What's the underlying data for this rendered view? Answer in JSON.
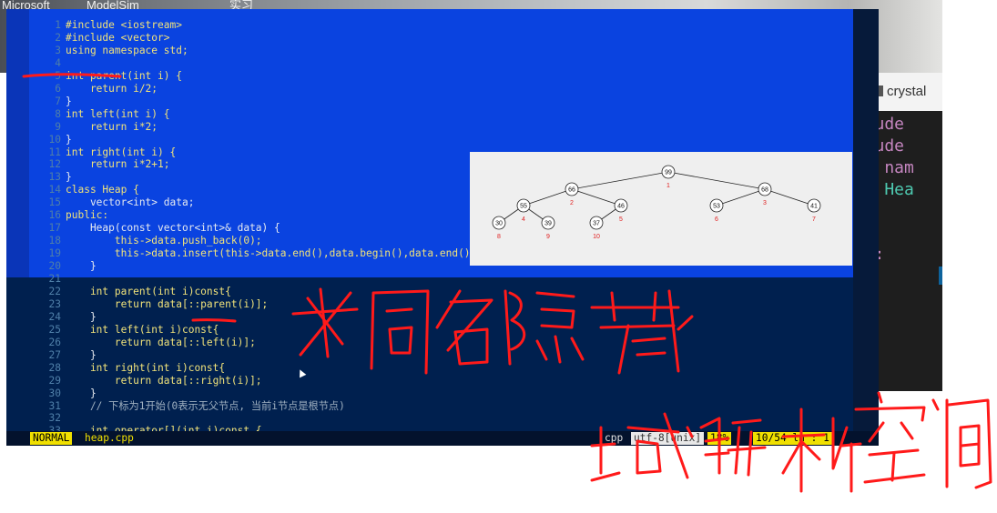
{
  "desktop": {
    "taskbar_items": [
      "Microsoft",
      "ModelSim",
      "实习"
    ]
  },
  "side_window": {
    "tab_label": "crystal",
    "code_fragments": [
      {
        "text": "nclude",
        "color": "#c586c0"
      },
      {
        "text": "nclude",
        "color": "#c586c0"
      },
      {
        "text": "ing nam",
        "color": "#c586c0"
      },
      {
        "text": "ass Hea",
        "color": "#4ec9b0"
      },
      {
        "text": "lic:",
        "color": "#c586c0"
      }
    ]
  },
  "editor": {
    "lines": [
      {
        "n": "1",
        "text": "#include <iostream>"
      },
      {
        "n": "2",
        "text": "#include <vector>"
      },
      {
        "n": "3",
        "text": "using namespace std;"
      },
      {
        "n": "4",
        "text": ""
      },
      {
        "n": "5",
        "text": "int parent(int i) {"
      },
      {
        "n": "6",
        "text": "    return i/2;"
      },
      {
        "n": "7",
        "text": "}"
      },
      {
        "n": "8",
        "text": "int left(int i) {"
      },
      {
        "n": "9",
        "text": "    return i*2;"
      },
      {
        "n": "10",
        "text": "}"
      },
      {
        "n": "11",
        "text": "int right(int i) {"
      },
      {
        "n": "12",
        "text": "    return i*2+1;"
      },
      {
        "n": "13",
        "text": "}"
      },
      {
        "n": "14",
        "text": "class Heap {"
      },
      {
        "n": "15",
        "text": "    vector<int> data;"
      },
      {
        "n": "16",
        "text": "public:"
      },
      {
        "n": "17",
        "text": "    Heap(const vector<int>& data) {"
      },
      {
        "n": "18",
        "text": "        this->data.push_back(0);"
      },
      {
        "n": "19",
        "text": "        this->data.insert(this->data.end(),data.begin(),data.end());"
      },
      {
        "n": "20",
        "text": "    }"
      },
      {
        "n": "21",
        "text": ""
      },
      {
        "n": "22",
        "text": "    int parent(int i)const{"
      },
      {
        "n": "23",
        "text": "        return data[::parent(i)];"
      },
      {
        "n": "24",
        "text": "    }"
      },
      {
        "n": "25",
        "text": "    int left(int i)const{"
      },
      {
        "n": "26",
        "text": "        return data[::left(i)];"
      },
      {
        "n": "27",
        "text": "    }"
      },
      {
        "n": "28",
        "text": "    int right(int i)const{"
      },
      {
        "n": "29",
        "text": "        return data[::right(i)];"
      },
      {
        "n": "30",
        "text": "    }"
      },
      {
        "n": "31",
        "text": "    // 下标为1开始(0表示无父节点, 当前i节点是根节点)"
      },
      {
        "n": "32",
        "text": ""
      },
      {
        "n": "33",
        "text": "    int operator[](int i)const {"
      }
    ]
  },
  "statusbar": {
    "mode": "NORMAL",
    "filename": "heap.cpp",
    "filetype": "cpp",
    "encoding": "utf-8[unix]",
    "percent": "18%",
    "position": "10/54 ln : 1"
  },
  "heap_tree": {
    "nodes": [
      {
        "value": "99",
        "index": "1"
      },
      {
        "value": "66",
        "index": "2"
      },
      {
        "value": "68",
        "index": "3"
      },
      {
        "value": "55",
        "index": "4"
      },
      {
        "value": "46",
        "index": "5"
      },
      {
        "value": "53",
        "index": "6"
      },
      {
        "value": "41",
        "index": "7"
      },
      {
        "value": "30",
        "index": "8"
      },
      {
        "value": "39",
        "index": "9"
      },
      {
        "value": "37",
        "index": "10"
      }
    ]
  },
  "annotations": {
    "handwriting_1": "一 *同名隐藏",
    "handwriting_2": "域解析空间",
    "ink_color": "#ff1a1a"
  }
}
